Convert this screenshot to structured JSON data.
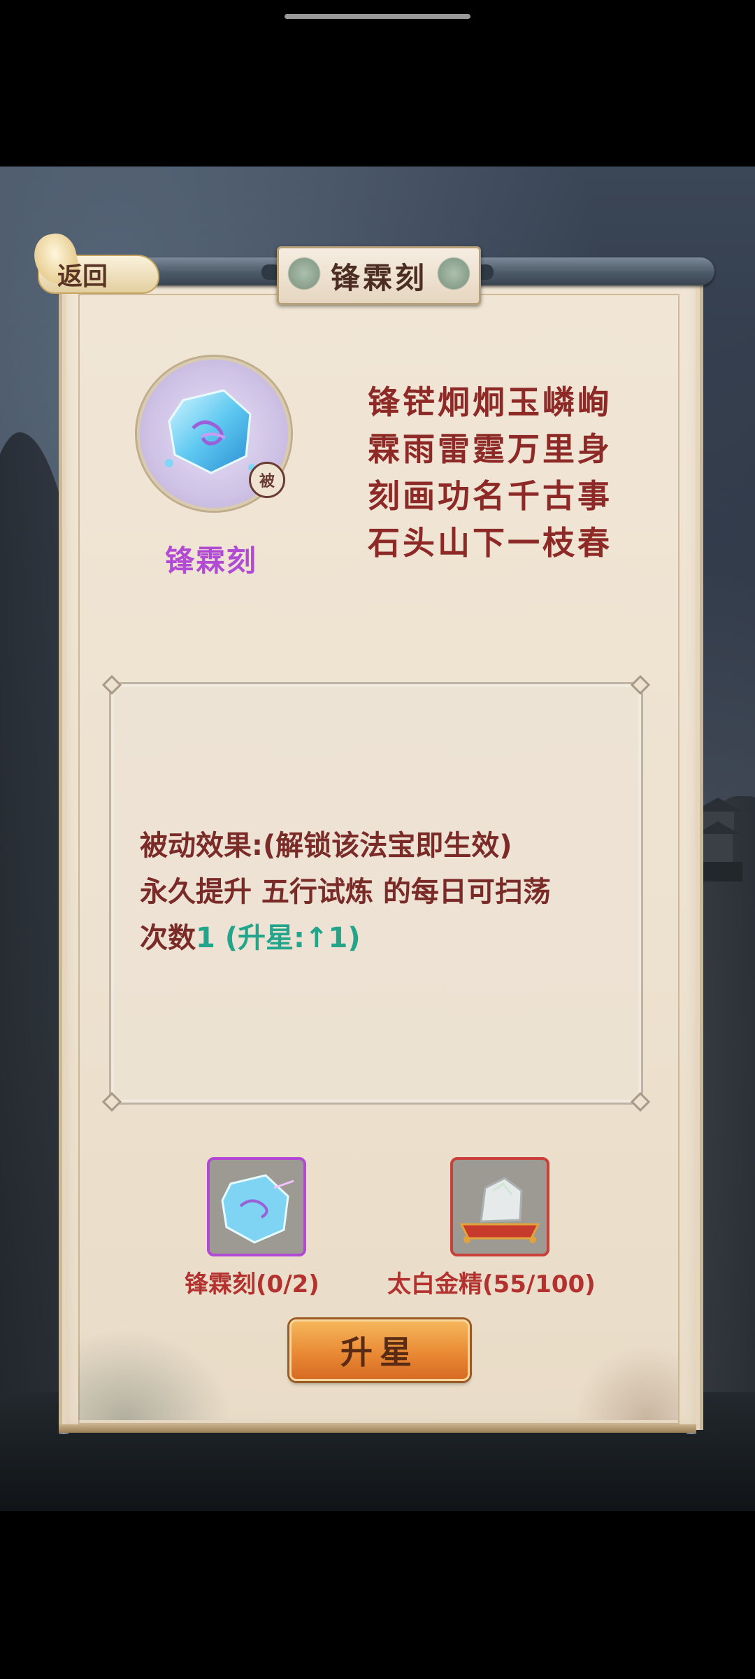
{
  "header": {
    "title": "锋霖刻",
    "back_label": "返回"
  },
  "item": {
    "name": "锋霖刻",
    "badge": "被",
    "icon": "ice-crystal-icon",
    "name_color": "#b14bd3"
  },
  "poem": {
    "lines": [
      "锋铓炯炯玉嶙峋",
      "霖雨雷霆万里身",
      "刻画功名千古事",
      "石头山下一枝春"
    ]
  },
  "effect": {
    "line1": "被动效果:(解锁该法宝即生效)",
    "line2": "永久提升 五行试炼 的每日可扫荡",
    "line3_prefix": "次数",
    "line3_value": "1",
    "line3_bonus": " (升星:↑1)"
  },
  "materials": [
    {
      "label": "锋霖刻(0/2)",
      "icon": "ice-crystal-icon",
      "frame_color": "#b249d4"
    },
    {
      "label": "太白金精(55/100)",
      "icon": "silver-ore-icon",
      "frame_color": "#c93f3a"
    }
  ],
  "actions": {
    "upgrade_label": "升星"
  },
  "colors": {
    "poem_text": "#8d2a27",
    "bonus_green": "#23a58c",
    "button_orange": "#e98a35"
  }
}
